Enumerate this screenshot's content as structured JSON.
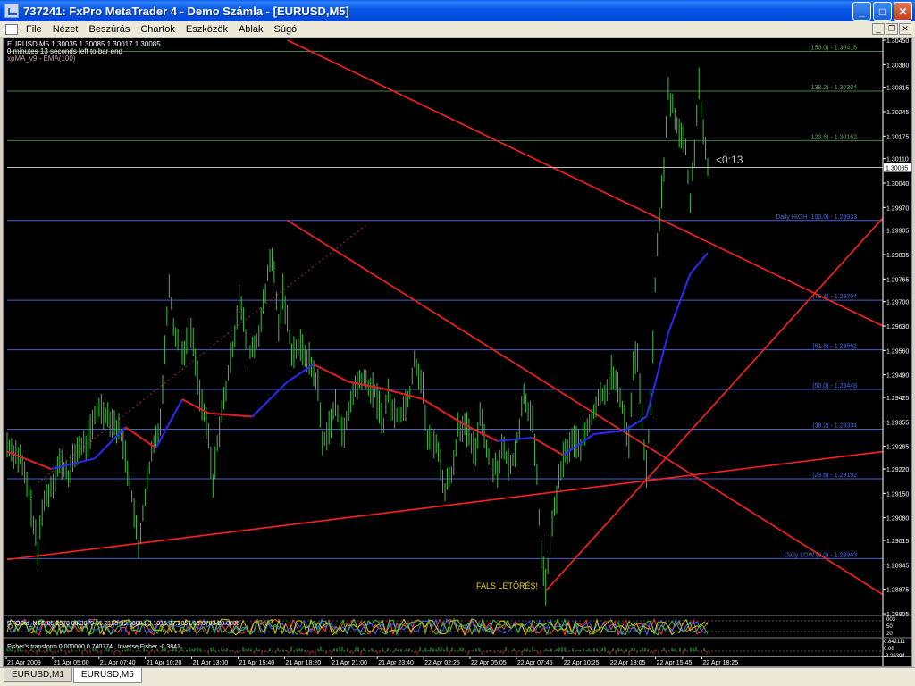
{
  "window": {
    "title": "737241: FxPro MetaTrader 4 - Demo Számla - [EURUSD,M5]"
  },
  "menu": [
    "File",
    "Nézet",
    "Beszúrás",
    "Chartok",
    "Eszközök",
    "Ablak",
    "Súgó"
  ],
  "tabs": [
    {
      "label": "EURUSD,M1",
      "active": false
    },
    {
      "label": "EURUSD,M5",
      "active": true
    }
  ],
  "chart": {
    "header_line1": "EURUSD,M5  1.30035 1.30085 1.30017 1.30085",
    "header_line2": "0 minutes 13 seconds left to bar end",
    "header_line3": "xpMA_v9 - EMA(100)",
    "countdown": "<0:13",
    "annotation": "FALS LETÖRÉS!",
    "current_price": "1.30085",
    "colors": {
      "background": "#000000",
      "candles": "#3fbf3f",
      "ema_up": "#2a2aff",
      "ema_down": "#e02020",
      "trendline": "#ff2020",
      "fib_line": "#3f7f3f",
      "fib_text": "#4a6bd0",
      "axis_text": "#ffffff"
    }
  },
  "chart_data": {
    "type": "candlestick",
    "price_ticks": [
      "1.30450",
      "1.30380",
      "1.30315",
      "1.30245",
      "1.30175",
      "1.30110",
      "1.30040",
      "1.29970",
      "1.29905",
      "1.29835",
      "1.29765",
      "1.29700",
      "1.29630",
      "1.29560",
      "1.29490",
      "1.29425",
      "1.29355",
      "1.29285",
      "1.29220",
      "1.29150",
      "1.29080",
      "1.29015",
      "1.28945",
      "1.28875",
      "1.28805"
    ],
    "price_range": [
      1.28805,
      1.3045
    ],
    "time_ticks": [
      "21 Apr 2009",
      "21 Apr 05:00",
      "21 Apr 07:40",
      "21 Apr 10:20",
      "21 Apr 13:00",
      "21 Apr 15:40",
      "21 Apr 18:20",
      "21 Apr 21:00",
      "21 Apr 23:40",
      "22 Apr 02:25",
      "22 Apr 05:05",
      "22 Apr 07:45",
      "22 Apr 10:25",
      "22 Apr 13:05",
      "22 Apr 15:45",
      "22 Apr 18:25"
    ],
    "fib_levels": [
      {
        "label": "(150.0) - 1.30418",
        "price": 1.30418
      },
      {
        "label": "(138.2) - 1.30304",
        "price": 1.30304
      },
      {
        "label": "(123.6) - 1.30162",
        "price": 1.30162
      },
      {
        "label": "Daily HIGH (100.0) - 1.29933",
        "price": 1.29933
      },
      {
        "label": "(76.4) - 1.29704",
        "price": 1.29704
      },
      {
        "label": "(61.8) - 1.29562",
        "price": 1.29562
      },
      {
        "label": "(50.0) - 1.29448",
        "price": 1.29448
      },
      {
        "label": "(38.2) - 1.29334",
        "price": 1.29334
      },
      {
        "label": "(23.6) - 1.29192",
        "price": 1.29192
      },
      {
        "label": "Daily LOW (0.0) - 1.28963",
        "price": 1.28963
      }
    ],
    "price_path": [
      [
        0,
        1.2929
      ],
      [
        3,
        1.2925
      ],
      [
        5,
        1.2915
      ],
      [
        7,
        1.2898
      ],
      [
        8,
        1.2911
      ],
      [
        10,
        1.2917
      ],
      [
        12,
        1.2924
      ],
      [
        14,
        1.292
      ],
      [
        16,
        1.2928
      ],
      [
        18,
        1.2929
      ],
      [
        21,
        1.294
      ],
      [
        24,
        1.2936
      ],
      [
        26,
        1.2932
      ],
      [
        27,
        1.2926
      ],
      [
        29,
        1.291
      ],
      [
        30,
        1.2898
      ],
      [
        31,
        1.291
      ],
      [
        33,
        1.2926
      ],
      [
        35,
        1.2936
      ],
      [
        36,
        1.2956
      ],
      [
        37,
        1.2976
      ],
      [
        38,
        1.2963
      ],
      [
        40,
        1.2955
      ],
      [
        42,
        1.2962
      ],
      [
        44,
        1.2944
      ],
      [
        46,
        1.2931
      ],
      [
        47,
        1.2917
      ],
      [
        48,
        1.293
      ],
      [
        50,
        1.2945
      ],
      [
        52,
        1.2961
      ],
      [
        53,
        1.2972
      ],
      [
        55,
        1.2955
      ],
      [
        57,
        1.2958
      ],
      [
        59,
        1.2972
      ],
      [
        60,
        1.2983
      ],
      [
        61,
        1.2978
      ],
      [
        62,
        1.2962
      ],
      [
        63,
        1.2973
      ],
      [
        65,
        1.2956
      ],
      [
        67,
        1.2957
      ],
      [
        69,
        1.2953
      ],
      [
        71,
        1.2946
      ],
      [
        72,
        1.2929
      ],
      [
        74,
        1.2936
      ],
      [
        75,
        1.294
      ],
      [
        77,
        1.2932
      ],
      [
        79,
        1.2944
      ],
      [
        81,
        1.2948
      ],
      [
        83,
        1.2945
      ],
      [
        84,
        1.2944
      ],
      [
        86,
        1.2935
      ],
      [
        87,
        1.2944
      ],
      [
        88,
        1.2938
      ],
      [
        90,
        1.2938
      ],
      [
        92,
        1.2944
      ],
      [
        93,
        1.2954
      ],
      [
        95,
        1.2945
      ],
      [
        96,
        1.293
      ],
      [
        98,
        1.293
      ],
      [
        100,
        1.2916
      ],
      [
        102,
        1.2923
      ],
      [
        103,
        1.2935
      ],
      [
        105,
        1.2933
      ],
      [
        107,
        1.2926
      ],
      [
        108,
        1.2939
      ],
      [
        110,
        1.2925
      ],
      [
        112,
        1.2922
      ],
      [
        113,
        1.2928
      ],
      [
        115,
        1.2922
      ],
      [
        117,
        1.2934
      ],
      [
        118,
        1.2944
      ],
      [
        120,
        1.2935
      ],
      [
        121,
        1.2919
      ],
      [
        122,
        1.2898
      ],
      [
        123,
        1.2888
      ],
      [
        124,
        1.29
      ],
      [
        125,
        1.2911
      ],
      [
        127,
        1.2925
      ],
      [
        129,
        1.293
      ],
      [
        131,
        1.2929
      ],
      [
        133,
        1.2935
      ],
      [
        135,
        1.2942
      ],
      [
        137,
        1.2945
      ],
      [
        138,
        1.295
      ],
      [
        140,
        1.2943
      ],
      [
        142,
        1.293
      ],
      [
        143,
        1.2952
      ],
      [
        144,
        1.2955
      ],
      [
        145,
        1.2935
      ],
      [
        146,
        1.2922
      ],
      [
        147,
        1.294
      ],
      [
        148,
        1.2975
      ],
      [
        149,
        1.2995
      ],
      [
        150,
        1.3008
      ],
      [
        151,
        1.303
      ],
      [
        153,
        1.3021
      ],
      [
        155,
        1.3014
      ],
      [
        156,
        1.2998
      ],
      [
        157,
        1.3014
      ],
      [
        158,
        1.3033
      ],
      [
        159,
        1.3017
      ],
      [
        160,
        1.3008
      ]
    ],
    "ema_points": [
      [
        0,
        1.2927
      ],
      [
        10,
        1.2922
      ],
      [
        20,
        1.2925
      ],
      [
        27,
        1.2934
      ],
      [
        34,
        1.2928
      ],
      [
        40,
        1.2942
      ],
      [
        46,
        1.2938
      ],
      [
        56,
        1.2937
      ],
      [
        64,
        1.2947
      ],
      [
        70,
        1.2952
      ],
      [
        78,
        1.2947
      ],
      [
        86,
        1.2945
      ],
      [
        95,
        1.2942
      ],
      [
        104,
        1.2935
      ],
      [
        112,
        1.293
      ],
      [
        120,
        1.2931
      ],
      [
        127,
        1.2926
      ],
      [
        134,
        1.2932
      ],
      [
        141,
        1.2933
      ],
      [
        146,
        1.2937
      ],
      [
        151,
        1.2961
      ],
      [
        156,
        1.2978
      ],
      [
        160,
        1.2984
      ]
    ],
    "trendlines": [
      {
        "name": "upper-resistance",
        "from": [
          64,
          1.3045
        ],
        "to": [
          200,
          1.2963
        ]
      },
      {
        "name": "middle-resistance",
        "from": [
          64,
          1.29933
        ],
        "to": [
          200,
          1.2886
        ]
      },
      {
        "name": "lower-support",
        "from": [
          0,
          1.2896
        ],
        "to": [
          200,
          1.2927
        ]
      },
      {
        "name": "steep-support",
        "from": [
          123,
          1.2887
        ],
        "to": [
          200,
          1.2994
        ]
      }
    ],
    "dotted_lines": [
      {
        "from": [
          7,
          1.2918
        ],
        "to": [
          82,
          1.2992
        ]
      }
    ]
  },
  "indicators": {
    "stoch_label": "STOStd_NTE 85.2978 88.3079 35.2159 89.3688 83.1016 37.2051 16.3783 28.0805",
    "stoch_ticks": [
      "003",
      "50",
      "20"
    ],
    "fisher_label": "Fisher's transform 0.000000 0.740774 , Inverse Fisher -0.3841",
    "fisher_ticks": [
      "0.842111",
      "0.00",
      "-3.26394"
    ]
  }
}
